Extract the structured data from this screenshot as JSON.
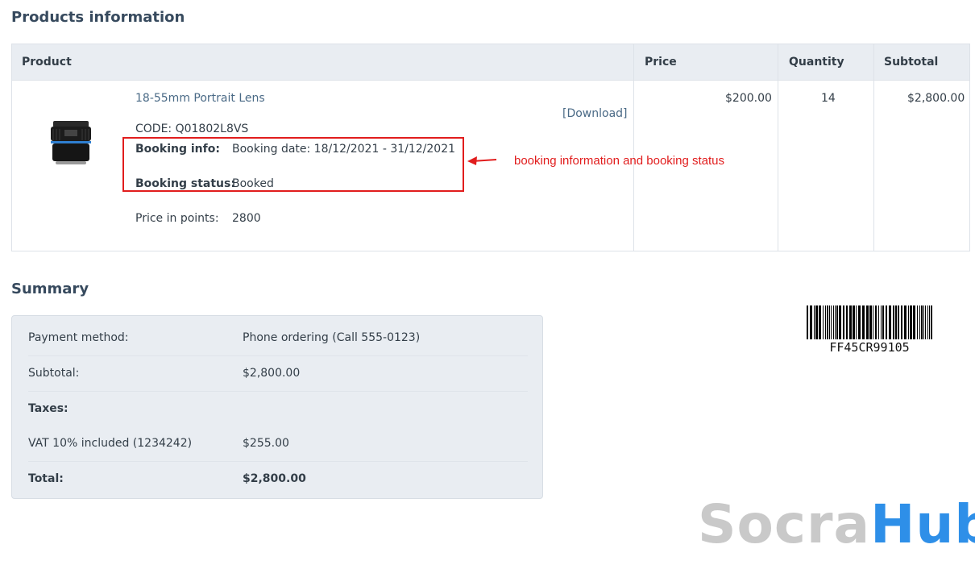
{
  "products_section": {
    "title": "Products information",
    "columns": {
      "product": "Product",
      "price": "Price",
      "quantity": "Quantity",
      "subtotal": "Subtotal"
    },
    "item": {
      "name": "18-55mm Portrait Lens",
      "download": "[Download]",
      "code": "CODE: Q01802L8VS",
      "booking_info_label": "Booking info:",
      "booking_info_value": "Booking date: 18/12/2021 - 31/12/2021",
      "booking_status_label": "Booking status:",
      "booking_status_value": "Booked",
      "price_points_label": "Price in points:",
      "price_points_value": "2800",
      "price": "$200.00",
      "quantity": "14",
      "subtotal": "$2,800.00"
    },
    "annotation": "booking information and booking status"
  },
  "summary": {
    "title": "Summary",
    "rows": [
      {
        "label": "Payment method:",
        "value": "Phone ordering (Call 555-0123)"
      },
      {
        "label": "Subtotal:",
        "value": "$2,800.00"
      },
      {
        "label": "Taxes:",
        "value": ""
      },
      {
        "label": "VAT 10% included (1234242)",
        "value": "$255.00"
      },
      {
        "label": "Total:",
        "value": "$2,800.00"
      }
    ]
  },
  "barcode": {
    "text": "FF45CR99105"
  },
  "watermark": {
    "part1": "Socra",
    "part2": "Hub"
  },
  "colors": {
    "highlight": "#e11d1d",
    "heading": "#374a5e",
    "header_bg": "#e9edf2",
    "brand_blue": "#2e8fe8"
  }
}
